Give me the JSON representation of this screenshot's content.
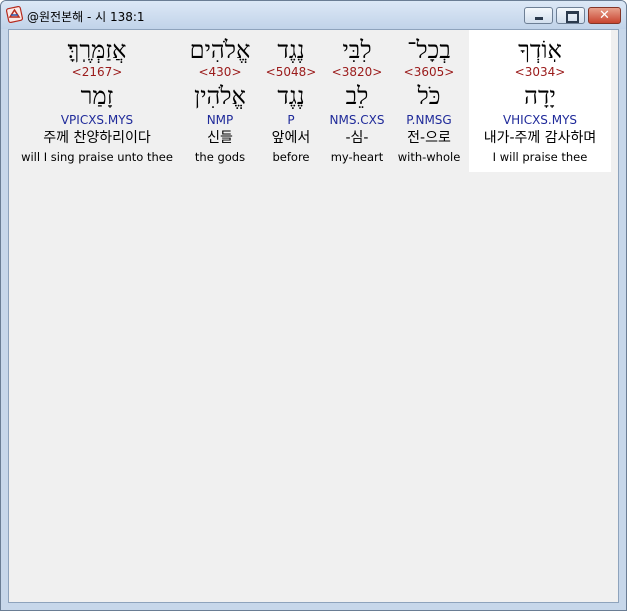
{
  "window": {
    "title": "@원전본해 - 시 138:1",
    "app_icon": "bible-app-icon",
    "minimize_icon": "minimize-icon",
    "maximize_icon": "maximize-icon",
    "close_icon": "close-icon",
    "close_glyph": "✕"
  },
  "words": [
    {
      "hebrew": "אֽוֹדְךָ",
      "strong": "<3034>",
      "lemma": "יָדָה",
      "morph": "VHICXS.MYS",
      "korean": "내가-주께 감사하며",
      "english": "I will praise thee",
      "selected": true
    },
    {
      "hebrew": "בְכָל־",
      "strong": "<3605>",
      "lemma": "כֹּל",
      "morph": "P.NMSG",
      "korean": "전-으로",
      "english": "with-whole",
      "selected": false
    },
    {
      "hebrew": "לִבִּי",
      "strong": "<3820>",
      "lemma": "לֵב",
      "morph": "NMS.CXS",
      "korean": "-심-",
      "english": "my-heart",
      "selected": false
    },
    {
      "hebrew": "נֶגֶד",
      "strong": "<5048>",
      "lemma": "נֶגֶד",
      "morph": "P",
      "korean": "앞에서",
      "english": "before",
      "selected": false
    },
    {
      "hebrew": "אֱלֹהִים",
      "strong": "<430>",
      "lemma": "אֱלֹהִין",
      "morph": "NMP",
      "korean": "신들",
      "english": "the gods",
      "selected": false
    },
    {
      "hebrew": "אֲזַמְּרֶֽךָּ׃",
      "strong": "<2167>",
      "lemma": "זָמַר",
      "morph": "VPICXS.MYS",
      "korean": "주께 찬양하리이다",
      "english": "will I sing praise unto thee",
      "selected": false
    }
  ]
}
